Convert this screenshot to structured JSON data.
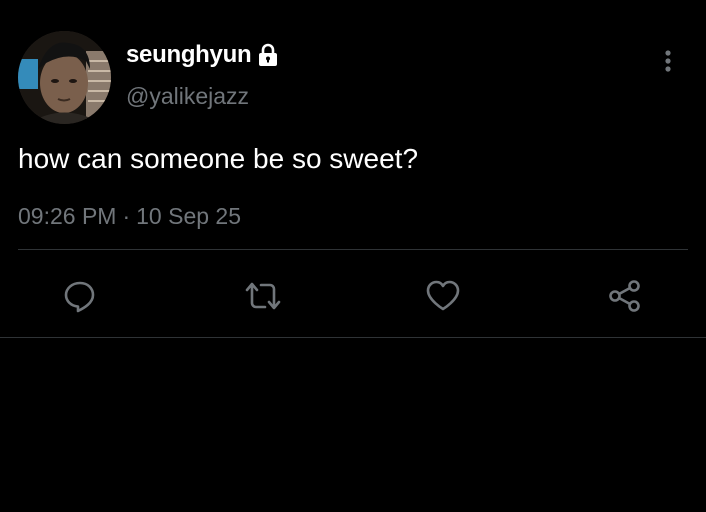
{
  "user": {
    "display_name": "seunghyun",
    "handle": "@yalikejazz",
    "protected_icon": "lock-icon",
    "avatar_icon": "avatar-photo"
  },
  "tweet": {
    "text": "how can someone be so sweet?",
    "time": "09:26 PM",
    "separator": "·",
    "date": "10 Sep 25"
  },
  "actions": [
    {
      "name": "reply",
      "icon": "reply-icon"
    },
    {
      "name": "retweet",
      "icon": "retweet-icon"
    },
    {
      "name": "like",
      "icon": "heart-icon"
    },
    {
      "name": "share",
      "icon": "share-icon"
    }
  ],
  "more_icon": "more-vertical-icon",
  "colors": {
    "background": "#000000",
    "primary_text": "#ffffff",
    "secondary_text": "#71767b",
    "divider": "#2f3336"
  }
}
